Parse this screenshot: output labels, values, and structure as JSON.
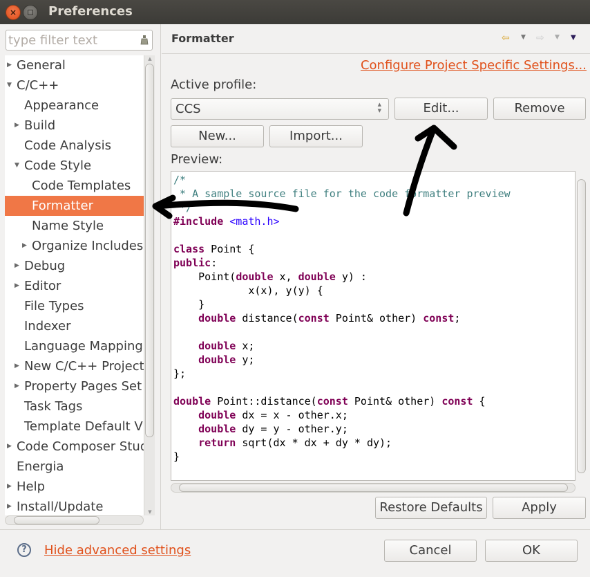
{
  "window": {
    "title": "Preferences",
    "close_glyph": "×"
  },
  "sidebar": {
    "filter_placeholder": "type filter text",
    "filter_value": "",
    "items": [
      {
        "label": "General",
        "level": 0,
        "expander": "collapsed"
      },
      {
        "label": "C/C++",
        "level": 0,
        "expander": "expanded"
      },
      {
        "label": "Appearance",
        "level": 1,
        "expander": "none"
      },
      {
        "label": "Build",
        "level": 1,
        "expander": "collapsed"
      },
      {
        "label": "Code Analysis",
        "level": 1,
        "expander": "none"
      },
      {
        "label": "Code Style",
        "level": 1,
        "expander": "expanded"
      },
      {
        "label": "Code Templates",
        "level": 2,
        "expander": "none"
      },
      {
        "label": "Formatter",
        "level": 2,
        "expander": "none",
        "selected": true
      },
      {
        "label": "Name Style",
        "level": 2,
        "expander": "none"
      },
      {
        "label": "Organize Includes",
        "level": 2,
        "expander": "collapsed"
      },
      {
        "label": "Debug",
        "level": 1,
        "expander": "collapsed"
      },
      {
        "label": "Editor",
        "level": 1,
        "expander": "collapsed"
      },
      {
        "label": "File Types",
        "level": 1,
        "expander": "none"
      },
      {
        "label": "Indexer",
        "level": 1,
        "expander": "none"
      },
      {
        "label": "Language Mapping",
        "level": 1,
        "expander": "none"
      },
      {
        "label": "New C/C++ Project",
        "level": 1,
        "expander": "collapsed"
      },
      {
        "label": "Property Pages Set",
        "level": 1,
        "expander": "collapsed"
      },
      {
        "label": "Task Tags",
        "level": 1,
        "expander": "none"
      },
      {
        "label": "Template Default V",
        "level": 1,
        "expander": "none"
      },
      {
        "label": "Code Composer Stud",
        "level": 0,
        "expander": "collapsed"
      },
      {
        "label": "Energia",
        "level": 0,
        "expander": "none"
      },
      {
        "label": "Help",
        "level": 0,
        "expander": "collapsed"
      },
      {
        "label": "Install/Update",
        "level": 0,
        "expander": "collapsed"
      }
    ]
  },
  "page": {
    "title": "Formatter",
    "nav_icons": [
      "back-arrow-icon",
      "back-menu-icon",
      "forward-arrow-icon",
      "forward-menu-icon",
      "view-menu-icon"
    ],
    "configure_link": "Configure Project Specific Settings...",
    "active_profile_label": "Active profile:",
    "active_profile_value": "CCS",
    "buttons": {
      "edit": "Edit...",
      "remove": "Remove",
      "new": "New...",
      "import": "Import...",
      "restore_defaults": "Restore Defaults",
      "apply": "Apply"
    },
    "preview_label": "Preview:",
    "preview_code": [
      [
        {
          "t": "/*",
          "c": "cm"
        }
      ],
      [
        {
          "t": " * A sample source file for the code formatter preview",
          "c": "cm"
        }
      ],
      [
        {
          "t": " */",
          "c": "cm"
        }
      ],
      [
        {
          "t": "#include",
          "c": "kw"
        },
        {
          "t": " ",
          "c": ""
        },
        {
          "t": "<math.h>",
          "c": "str"
        }
      ],
      [],
      [
        {
          "t": "class",
          "c": "kw"
        },
        {
          "t": " Point {",
          "c": ""
        }
      ],
      [
        {
          "t": "public",
          "c": "kw"
        },
        {
          "t": ":",
          "c": ""
        }
      ],
      [
        {
          "t": "    Point(",
          "c": ""
        },
        {
          "t": "double",
          "c": "kw"
        },
        {
          "t": " x, ",
          "c": ""
        },
        {
          "t": "double",
          "c": "kw"
        },
        {
          "t": " y) :",
          "c": ""
        }
      ],
      [
        {
          "t": "            x(x), y(y) {",
          "c": ""
        }
      ],
      [
        {
          "t": "    }",
          "c": ""
        }
      ],
      [
        {
          "t": "    ",
          "c": ""
        },
        {
          "t": "double",
          "c": "kw"
        },
        {
          "t": " distance(",
          "c": ""
        },
        {
          "t": "const",
          "c": "kw"
        },
        {
          "t": " Point& other) ",
          "c": ""
        },
        {
          "t": "const",
          "c": "kw"
        },
        {
          "t": ";",
          "c": ""
        }
      ],
      [],
      [
        {
          "t": "    ",
          "c": ""
        },
        {
          "t": "double",
          "c": "kw"
        },
        {
          "t": " x;",
          "c": ""
        }
      ],
      [
        {
          "t": "    ",
          "c": ""
        },
        {
          "t": "double",
          "c": "kw"
        },
        {
          "t": " y;",
          "c": ""
        }
      ],
      [
        {
          "t": "};",
          "c": ""
        }
      ],
      [],
      [
        {
          "t": "double",
          "c": "kw"
        },
        {
          "t": " Point::distance(",
          "c": ""
        },
        {
          "t": "const",
          "c": "kw"
        },
        {
          "t": " Point& other) ",
          "c": ""
        },
        {
          "t": "const",
          "c": "kw"
        },
        {
          "t": " {",
          "c": ""
        }
      ],
      [
        {
          "t": "    ",
          "c": ""
        },
        {
          "t": "double",
          "c": "kw"
        },
        {
          "t": " dx = x - other.x;",
          "c": ""
        }
      ],
      [
        {
          "t": "    ",
          "c": ""
        },
        {
          "t": "double",
          "c": "kw"
        },
        {
          "t": " dy = y - other.y;",
          "c": ""
        }
      ],
      [
        {
          "t": "    ",
          "c": ""
        },
        {
          "t": "return",
          "c": "kw"
        },
        {
          "t": " sqrt(dx * dx + dy * dy);",
          "c": ""
        }
      ],
      [
        {
          "t": "}",
          "c": ""
        }
      ]
    ]
  },
  "footer": {
    "help_glyph": "?",
    "hide_advanced_link": "Hide advanced settings",
    "cancel": "Cancel",
    "ok": "OK"
  },
  "colors": {
    "selection": "#f07746",
    "link": "#e0501a",
    "keyword": "#7f0055",
    "comment": "#3f7f7f",
    "string": "#2a00ff"
  },
  "annotations": {
    "arrows": [
      "arrow pointing to Formatter tree item",
      "arrow pointing to Edit... button"
    ]
  }
}
